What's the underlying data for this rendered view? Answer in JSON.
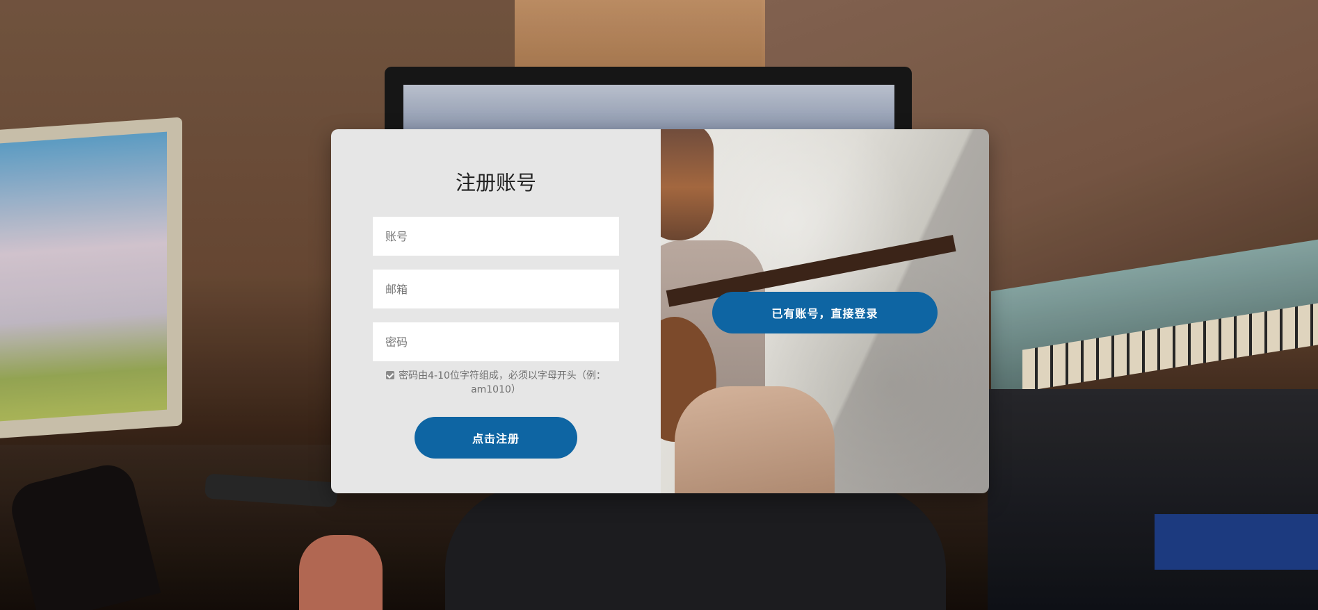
{
  "page": {
    "title": "注册账号"
  },
  "register_form": {
    "title": "注册账号",
    "account_placeholder": "账号",
    "email_placeholder": "邮箱",
    "password_placeholder": "密码",
    "password_hint": "密码由4-10位字符组成，必须以字母开头（例：am1010）",
    "submit_label": "点击注册"
  },
  "side_panel": {
    "login_label": "已有账号，直接登录"
  },
  "colors": {
    "primary_button": "#0e65a3",
    "form_background": "#e6e6e6"
  },
  "icons": {
    "hint_checkbox": "checkbox-checked-icon"
  }
}
